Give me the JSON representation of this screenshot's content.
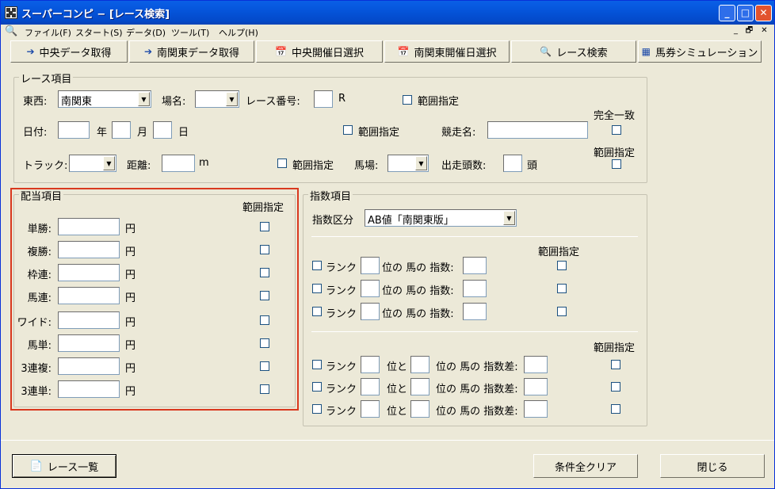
{
  "window": {
    "title": "スーパーコンピ − [レース検索]"
  },
  "menu": [
    "ファイル(F)",
    "スタート(S)",
    "データ(D)",
    "ツール(T)",
    "ヘルプ(H)"
  ],
  "toolbar": {
    "central_fetch": "中央データ取得",
    "south_kanto_fetch": "南関東データ取得",
    "central_date_select": "中央開催日選択",
    "south_kanto_date_select": "南関東開催日選択",
    "race_search": "レース検索",
    "ticket_sim": "馬券シミュレーション"
  },
  "race_items": {
    "group_title": "レース項目",
    "east_west_label": "東西:",
    "east_west_value": "南関東",
    "venue_label": "場名:",
    "venue_value": "",
    "race_no_label": "レース番号:",
    "race_no_value": "",
    "race_no_unit": "R",
    "range_label": "範囲指定",
    "date_label": "日付:",
    "year_unit": "年",
    "month_unit": "月",
    "day_unit": "日",
    "race_name_label": "競走名:",
    "race_name_value": "",
    "exact_match_label": "完全一致",
    "track_label": "トラック:",
    "distance_label": "距離:",
    "distance_unit": "m",
    "going_label": "馬場:",
    "runners_label": "出走頭数:",
    "runners_unit": "頭"
  },
  "payout_items": {
    "group_title": "配当項目",
    "range_header": "範囲指定",
    "unit": "円",
    "rows": [
      {
        "label": "単勝:",
        "value": ""
      },
      {
        "label": "複勝:",
        "value": ""
      },
      {
        "label": "枠連:",
        "value": ""
      },
      {
        "label": "馬連:",
        "value": ""
      },
      {
        "label": "ワイド:",
        "value": ""
      },
      {
        "label": "馬単:",
        "value": ""
      },
      {
        "label": "3連複:",
        "value": ""
      },
      {
        "label": "3連単:",
        "value": ""
      }
    ]
  },
  "index_items": {
    "group_title": "指数項目",
    "type_label": "指数区分",
    "type_value": "AB値「南関東版」",
    "range_header": "範囲指定",
    "rank_label": "ランク",
    "rank_row_mid": "位の 馬の 指数:",
    "diff_row_to": "位と",
    "diff_row_mid": "位の 馬の 指数差:"
  },
  "footer": {
    "race_list_button": "レース一覧",
    "clear_button": "条件全クリア",
    "close_button": "閉じる"
  },
  "colors": {
    "title_bar": "#0555DB",
    "payout_highlight": "#D9381E",
    "window_bg": "#ECE9D8"
  }
}
